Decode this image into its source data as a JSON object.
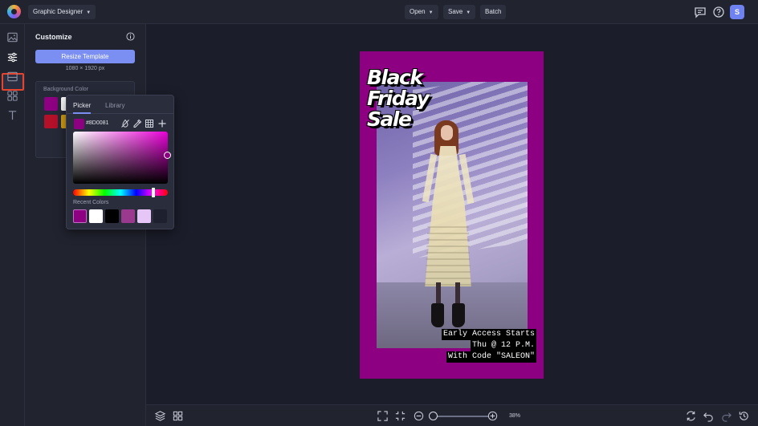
{
  "topbar": {
    "mode": "Graphic Designer",
    "open_label": "Open",
    "save_label": "Save",
    "batch_label": "Batch",
    "avatar_initial": "S"
  },
  "panel": {
    "title": "Customize",
    "resize_button": "Resize Template",
    "dimensions": "1080 × 1920 px",
    "background_color_label": "Background Color"
  },
  "color_picker": {
    "tabs": [
      "Picker",
      "Library"
    ],
    "hex": "#8D0081",
    "recent_label": "Recent Colors",
    "recent_colors": [
      "#8d0081",
      "#ffffff",
      "#000000",
      "#9a3a8f",
      "#e6c6f6",
      "#1e2030"
    ]
  },
  "background_swatches": [
    "#8d0081",
    "#ffffff",
    "#b3102a",
    "#d4a019"
  ],
  "canvas": {
    "background": "#8d0081",
    "headline": [
      "Black",
      "Friday",
      "Sale"
    ],
    "promo_lines": [
      "Early Access Starts",
      "Thu @ 12 P.M.",
      "With Code \"SALEON\""
    ]
  },
  "bottombar": {
    "zoom": "38%",
    "zoom_level": 0.38
  },
  "colors": {
    "accent": "#7b8ef2",
    "highlight": "#e8432c"
  }
}
